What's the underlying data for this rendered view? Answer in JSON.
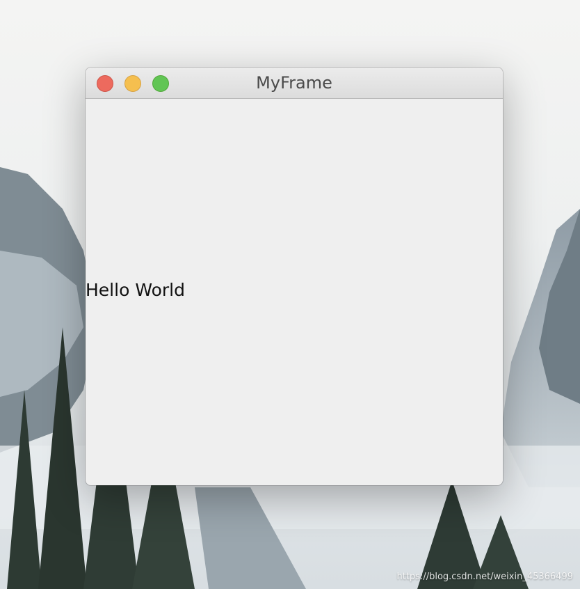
{
  "window": {
    "title": "MyFrame"
  },
  "content": {
    "label_text": "Hello World"
  },
  "watermark": {
    "text": "https://blog.csdn.net/weixin_45366499"
  },
  "colors": {
    "close_button": "#ed6a5e",
    "minimize_button": "#f5bf4f",
    "maximize_button": "#61c554",
    "window_background": "#efefef"
  }
}
